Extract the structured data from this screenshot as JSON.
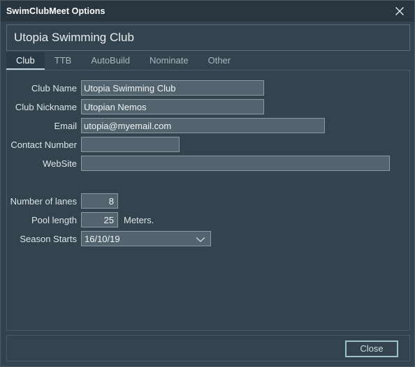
{
  "window": {
    "title": "SwimClubMeet Options",
    "close_icon": "close-icon"
  },
  "header": {
    "club_title": "Utopia Swimming Club"
  },
  "tabs": [
    {
      "label": "Club",
      "active": true
    },
    {
      "label": "TTB",
      "active": false
    },
    {
      "label": "AutoBuild",
      "active": false
    },
    {
      "label": "Nominate",
      "active": false
    },
    {
      "label": "Other",
      "active": false
    }
  ],
  "form": {
    "club_name": {
      "label": "Club Name",
      "value": "Utopia Swimming Club"
    },
    "club_nickname": {
      "label": "Club Nickname",
      "value": "Utopian Nemos"
    },
    "email": {
      "label": "Email",
      "value": "utopia@myemail.com"
    },
    "contact_number": {
      "label": "Contact Number",
      "value": ""
    },
    "website": {
      "label": "WebSite",
      "value": ""
    },
    "number_of_lanes": {
      "label": "Number of lanes",
      "value": "8"
    },
    "pool_length": {
      "label": "Pool length",
      "value": "25",
      "suffix": "Meters."
    },
    "season_starts": {
      "label": "Season Starts",
      "value": "16/10/19",
      "arrow_icon": "chevron-down-icon"
    }
  },
  "footer": {
    "close_label": "Close"
  },
  "colors": {
    "window_bg": "#33444f",
    "titlebar_bg": "#29363f",
    "input_bg": "#53646f",
    "input_border": "#8c9aa3",
    "accent_focus": "#9fc2c9",
    "tab_active_bg": "#2b3a47",
    "tab_active_underline": "#bcd4dc",
    "text": "#dfe6ea"
  }
}
